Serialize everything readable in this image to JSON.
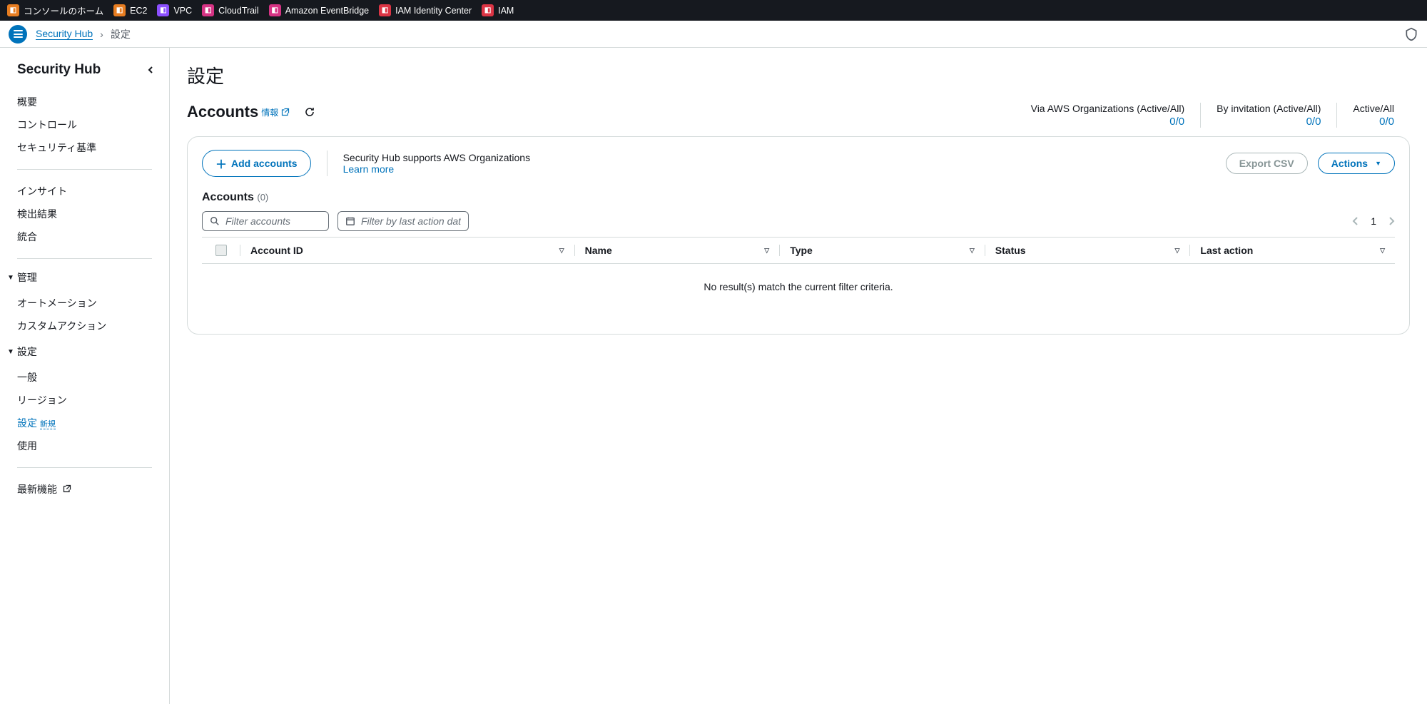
{
  "topbar": {
    "items": [
      {
        "label": "コンソールのホーム",
        "color": "tb-orange"
      },
      {
        "label": "EC2",
        "color": "tb-orange"
      },
      {
        "label": "VPC",
        "color": "tb-purple"
      },
      {
        "label": "CloudTrail",
        "color": "tb-pink"
      },
      {
        "label": "Amazon EventBridge",
        "color": "tb-pink"
      },
      {
        "label": "IAM Identity Center",
        "color": "tb-red"
      },
      {
        "label": "IAM",
        "color": "tb-red"
      }
    ]
  },
  "breadcrumb": {
    "root": "Security Hub",
    "current": "設定"
  },
  "sidebar": {
    "title": "Security Hub",
    "sectionA": [
      "概要",
      "コントロール",
      "セキュリティ基準"
    ],
    "sectionB": [
      "インサイト",
      "検出結果",
      "統合"
    ],
    "groupManage": "管理",
    "manageItems": [
      "オートメーション",
      "カスタムアクション"
    ],
    "groupSettings": "設定",
    "settingsItems": {
      "general": "一般",
      "region": "リージョン",
      "settings": "設定",
      "settings_badge": "新規",
      "usage": "使用"
    },
    "latest": "最新機能"
  },
  "page": {
    "title": "設定"
  },
  "accounts": {
    "title": "Accounts",
    "info_label": "情報",
    "stats": [
      {
        "label": "Via AWS Organizations (Active/All)",
        "value": "0/0"
      },
      {
        "label": "By invitation (Active/All)",
        "value": "0/0"
      },
      {
        "label": "Active/All",
        "value": "0/0"
      }
    ],
    "add_btn": "Add accounts",
    "org_msg": "Security Hub supports AWS Organizations",
    "learn_more": "Learn more",
    "export_btn": "Export CSV",
    "actions_btn": "Actions",
    "sub_title": "Accounts",
    "count": "(0)",
    "filter_placeholder": "Filter accounts",
    "filter_date_placeholder": "Filter by last action date",
    "page_num": "1",
    "columns": {
      "id": "Account ID",
      "name": "Name",
      "type": "Type",
      "status": "Status",
      "last": "Last action"
    },
    "empty": "No result(s) match the current filter criteria."
  }
}
